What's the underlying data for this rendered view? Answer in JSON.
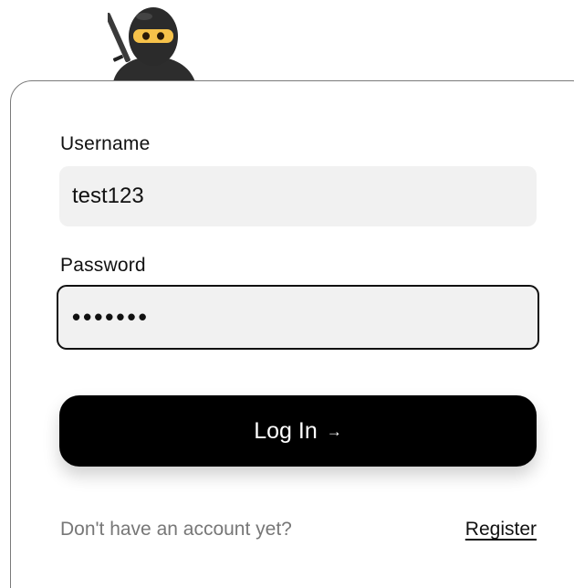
{
  "form": {
    "username": {
      "label": "Username",
      "value": "test123"
    },
    "password": {
      "label": "Password",
      "value": "•••••••"
    },
    "login_button": {
      "label": "Log In",
      "arrow": "→"
    }
  },
  "footer": {
    "prompt": "Don't have an account yet?",
    "register_link": "Register"
  },
  "mascot": {
    "icon": "ninja-icon"
  },
  "colors": {
    "button_bg": "#000000",
    "input_bg": "#f1f1f1",
    "muted_text": "#777777"
  }
}
